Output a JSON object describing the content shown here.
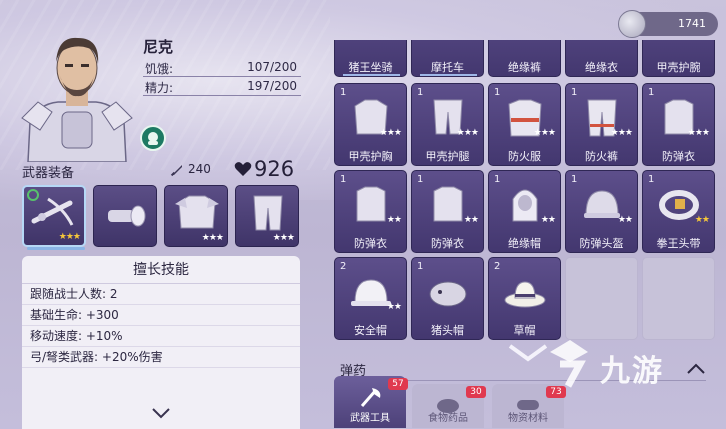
{
  "character": {
    "name": "尼克",
    "hunger_label": "饥饿:",
    "hunger_value": "107/200",
    "energy_label": "精力:",
    "energy_value": "197/200"
  },
  "equipment": {
    "title": "武器装备",
    "attack": "240",
    "health": "926",
    "slots": [
      {
        "icon": "crossbow-icon",
        "stars": "★★★",
        "gold": true
      },
      {
        "icon": "flashlight-icon",
        "stars": ""
      },
      {
        "icon": "shell-armor-icon",
        "stars": "★★★",
        "gold": false
      },
      {
        "icon": "leg-guard-icon",
        "stars": "★★★",
        "gold": false
      }
    ]
  },
  "skills": {
    "title": "擅长技能",
    "rows": [
      "跟随战士人数: 2",
      "基础生命: +300",
      "移动速度: +10%",
      "弓/弩类武器: +20%伤害"
    ]
  },
  "resource": {
    "value": "1741"
  },
  "inventory": {
    "top_row": [
      "猪王坐骑",
      "摩托车",
      "绝缘裤",
      "绝缘衣",
      "甲壳护腕"
    ],
    "items": [
      {
        "count": "1",
        "name": "甲壳护胸",
        "stars": "★★★",
        "gold": false,
        "icon": "shell-chest-icon"
      },
      {
        "count": "1",
        "name": "甲壳护腿",
        "stars": "★★★",
        "gold": false,
        "icon": "shell-legs-icon"
      },
      {
        "count": "1",
        "name": "防火服",
        "stars": "★★★",
        "gold": false,
        "icon": "fire-suit-icon"
      },
      {
        "count": "1",
        "name": "防火裤",
        "stars": "★★★",
        "gold": false,
        "icon": "fire-pants-icon"
      },
      {
        "count": "1",
        "name": "防弹衣",
        "stars": "★★★",
        "gold": false,
        "icon": "vest-icon"
      },
      {
        "count": "1",
        "name": "防弹衣",
        "stars": "★★",
        "gold": false,
        "icon": "vest-icon"
      },
      {
        "count": "1",
        "name": "防弹衣",
        "stars": "★★",
        "gold": false,
        "icon": "vest-icon"
      },
      {
        "count": "1",
        "name": "绝缘帽",
        "stars": "★★",
        "gold": false,
        "icon": "hood-icon"
      },
      {
        "count": "1",
        "name": "防弹头盔",
        "stars": "★★",
        "gold": false,
        "icon": "helmet-icon"
      },
      {
        "count": "1",
        "name": "拳王头带",
        "stars": "★★",
        "gold": true,
        "icon": "headband-icon"
      },
      {
        "count": "2",
        "name": "安全帽",
        "stars": "★★",
        "gold": false,
        "icon": "hardhat-icon"
      },
      {
        "count": "1",
        "name": "猪头帽",
        "stars": "",
        "gold": false,
        "icon": "boar-hat-icon"
      },
      {
        "count": "2",
        "name": "草帽",
        "stars": "",
        "gold": false,
        "icon": "straw-hat-icon"
      }
    ],
    "category": "弹药"
  },
  "tabs": [
    {
      "label": "武器工具",
      "badge": "57"
    },
    {
      "label": "食物药品",
      "badge": "30"
    },
    {
      "label": "物资材料",
      "badge": "73"
    }
  ],
  "watermark": {
    "text": "九游"
  },
  "colors": {
    "panel": "#5d4f8b",
    "badge": "#e0394f",
    "gold_star": "#f6c73a"
  }
}
